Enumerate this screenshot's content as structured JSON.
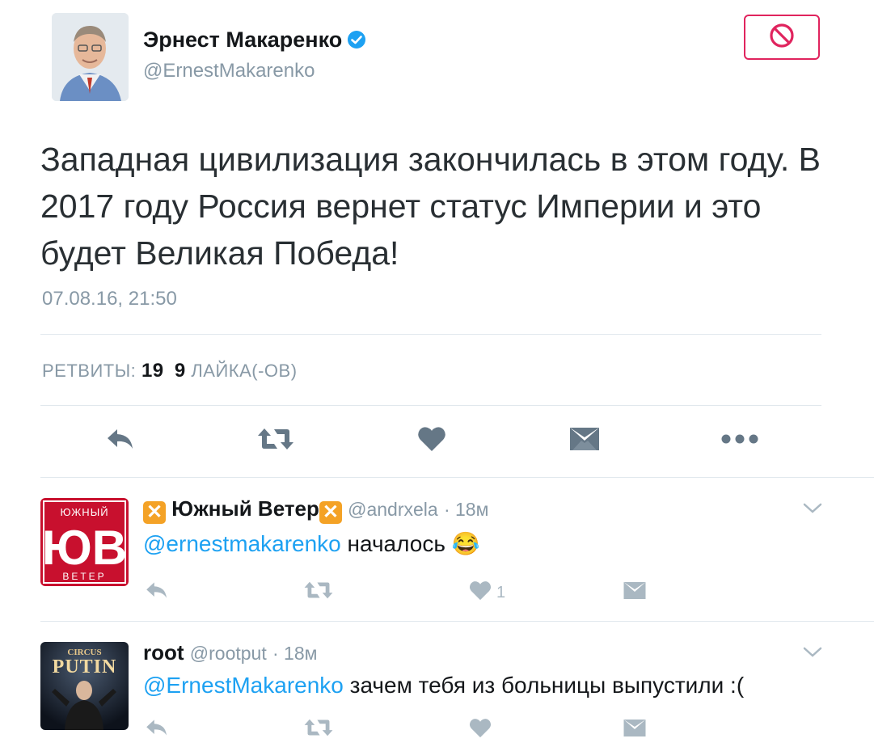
{
  "author": {
    "display_name": "Эрнест Макаренко",
    "handle": "@ErnestMakarenko",
    "verified": true
  },
  "tweet": {
    "text": "Западная цивилизация закончилась в этом году. В 2017 году Россия вернет статус Империи и это будет Великая Победа!",
    "timestamp": "07.08.16, 21:50"
  },
  "stats": {
    "retweets_label": "РЕТВИТЫ:",
    "retweets_count": "19",
    "likes_count": "9",
    "likes_label": "ЛАЙКА(-ОВ)"
  },
  "actions": [
    "reply-icon",
    "retweet-icon",
    "heart-icon",
    "dm-icon",
    "more-icon"
  ],
  "replies": [
    {
      "name_prefix_emoji": "❎",
      "display_name": "Южный Ветер",
      "name_suffix_emoji": "❎",
      "handle": "@andrxela",
      "time": "· 18м",
      "mention": "@ernestmakarenko",
      "text": "началось",
      "emoji": "😂",
      "like_count": "1",
      "avatar_text_top": "ЮЖНЫЙ",
      "avatar_text_main": "ЮВ",
      "avatar_text_bottom": "ВЕТЕР"
    },
    {
      "display_name": "root",
      "handle": "@rootput",
      "time": "· 18м",
      "mention": "@ErnestMakarenko",
      "text": "зачем тебя из больницы выпустили :(",
      "avatar_text_top": "CIRCUS",
      "avatar_text_main": "PUTIN"
    }
  ],
  "colors": {
    "accent": "#1da1f2",
    "block": "#e0245e",
    "muted": "#8899a6",
    "icon": "#657786"
  }
}
